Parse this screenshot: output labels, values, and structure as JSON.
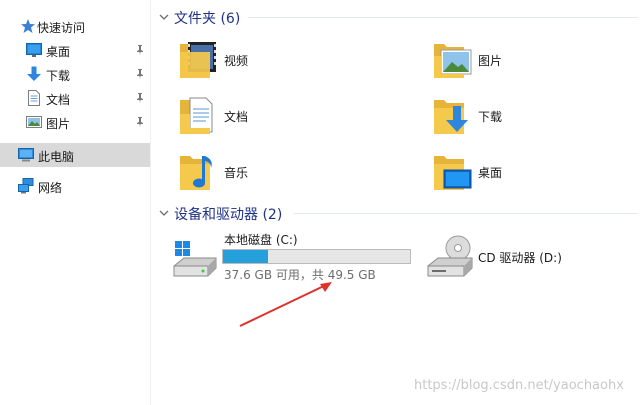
{
  "sidebar": {
    "quick_access": "快速访问",
    "items": [
      {
        "label": "桌面",
        "icon": "desktop-icon",
        "pinned": true
      },
      {
        "label": "下载",
        "icon": "download-icon",
        "pinned": true
      },
      {
        "label": "文档",
        "icon": "document-icon",
        "pinned": true
      },
      {
        "label": "图片",
        "icon": "pictures-icon",
        "pinned": true
      }
    ],
    "this_pc": "此电脑",
    "network": "网络"
  },
  "folders_group": {
    "title": "文件夹 (6)",
    "items": [
      {
        "label": "视频",
        "icon": "videos-folder-icon"
      },
      {
        "label": "图片",
        "icon": "pictures-folder-icon"
      },
      {
        "label": "文档",
        "icon": "documents-folder-icon"
      },
      {
        "label": "下载",
        "icon": "downloads-folder-icon"
      },
      {
        "label": "音乐",
        "icon": "music-folder-icon"
      },
      {
        "label": "桌面",
        "icon": "desktop-folder-icon"
      }
    ]
  },
  "drives_group": {
    "title": "设备和驱动器 (2)",
    "local_disk": {
      "name": "本地磁盘 (C:)",
      "detail": "37.6 GB 可用，共 49.5 GB",
      "used_fraction": 0.24
    },
    "cd_drive": {
      "name": "CD 驱动器 (D:)"
    }
  },
  "watermark": "https://blog.csdn.net/yaochaohx",
  "colors": {
    "group_title": "#1e3287",
    "progress_fill": "#26a0da",
    "selected_bg": "#d9d9d9",
    "annotation_arrow": "#e0302a",
    "folder_yellow": "#f5c94c"
  }
}
